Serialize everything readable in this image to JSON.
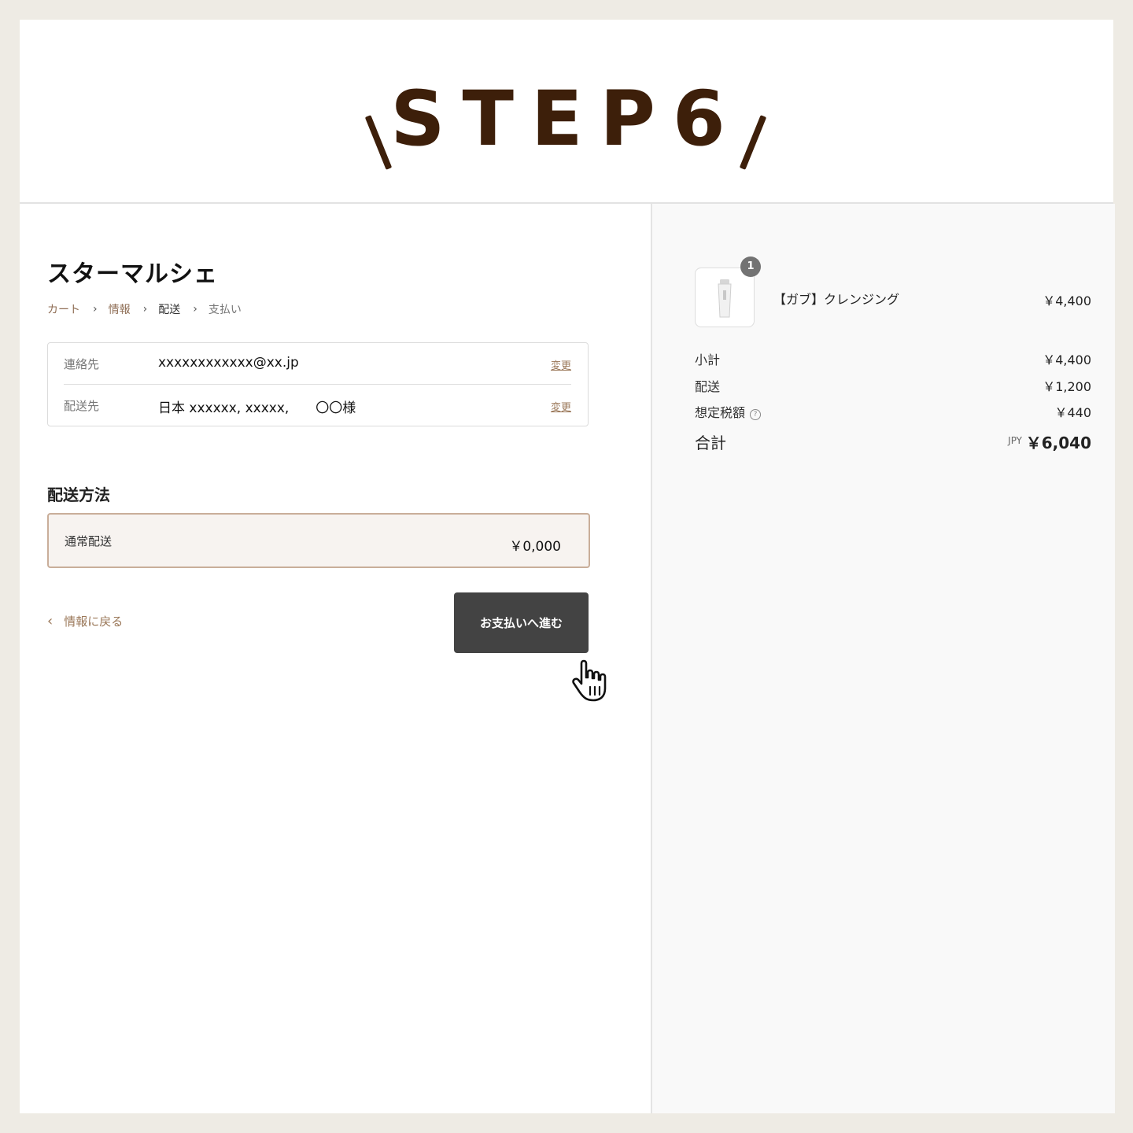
{
  "banner": {
    "title": "STEP6"
  },
  "store": {
    "name": "スターマルシェ"
  },
  "breadcrumb": [
    {
      "label": "カート",
      "state": "done"
    },
    {
      "label": "情報",
      "state": "done"
    },
    {
      "label": "配送",
      "state": "current"
    },
    {
      "label": "支払い",
      "state": "pending"
    }
  ],
  "contact": {
    "label": "連絡先",
    "value": "xxxxxxxxxxxx@xx.jp",
    "change_label": "変更"
  },
  "shipping_address": {
    "label": "配送先",
    "value": "日本 xxxxxx, xxxxx,　　〇〇様",
    "change_label": "変更"
  },
  "shipping_method": {
    "section_title": "配送方法",
    "name": "通常配送",
    "price": "￥0,000"
  },
  "actions": {
    "back_label": "情報に戻る",
    "continue_label": "お支払いへ進む"
  },
  "order": {
    "product": {
      "name": "【ガブ】クレンジング",
      "price": "￥4,400",
      "quantity": "1"
    },
    "subtotal": {
      "label": "小計",
      "value": "￥4,400"
    },
    "shipping": {
      "label": "配送",
      "value": "￥1,200"
    },
    "tax": {
      "label": "想定税額",
      "value": "￥440"
    },
    "total": {
      "label": "合計",
      "currency": "JPY",
      "value": "￥6,040"
    }
  },
  "colors": {
    "banner_text": "#3d1f0a",
    "accent_link": "#9a7758",
    "button_bg": "#434343",
    "selected_border": "#c9ae9a",
    "page_bg": "#eeebe4"
  },
  "icons": [
    "chevron-right-icon",
    "chevron-left-icon",
    "help-circle-icon",
    "pointer-hand-icon",
    "product-tube-icon"
  ]
}
